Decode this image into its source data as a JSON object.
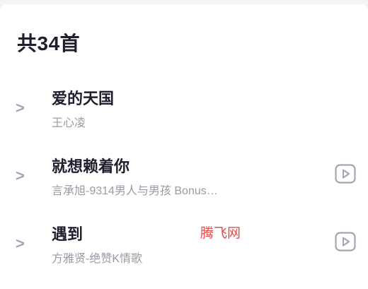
{
  "list": {
    "count_label": "共34首",
    "songs": [
      {
        "title": "爱的天国",
        "subtitle": "王心凌",
        "has_video": false
      },
      {
        "title": "就想赖着你",
        "subtitle": "言承旭-9314男人与男孩 Bonus…",
        "has_video": true
      },
      {
        "title": "遇到",
        "subtitle": "方雅贤-绝赞K情歌",
        "has_video": true
      }
    ]
  },
  "icons": {
    "expand": "chevron-right-icon",
    "video": "play-video-icon",
    "expand_glyph": ">"
  },
  "watermark": {
    "text": "腾飞网"
  },
  "colors": {
    "title": "#1e1e2c",
    "subtitle": "#9a9aa6",
    "icon": "#a4a4b4",
    "watermark": "#e84a4a"
  }
}
